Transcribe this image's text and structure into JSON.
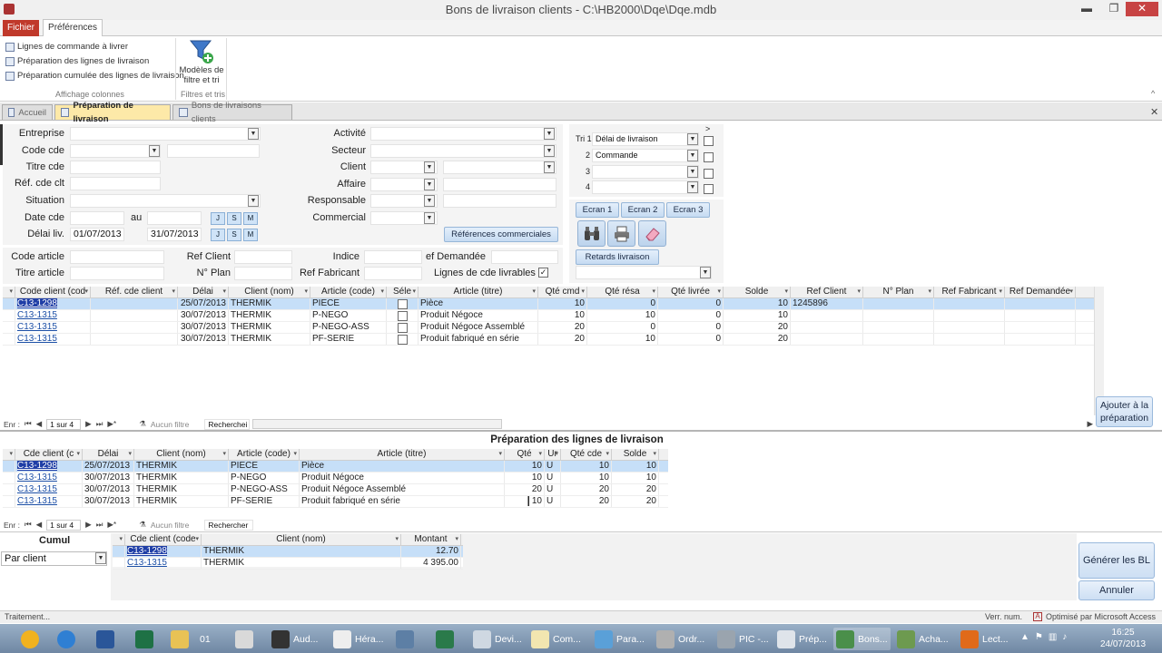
{
  "window": {
    "title": "Bons de livraison clients - C:\\HB2000\\Dqe\\Dqe.mdb",
    "minimize": "▬",
    "restore": "❐",
    "close": "✕"
  },
  "ribbon": {
    "file_tab": "Fichier",
    "prefs_tab": "Préférences",
    "items": [
      "Lignes de commande à livrer",
      "Préparation des lignes de livraison",
      "Préparation cumulée des lignes de livraison"
    ],
    "group1": "Affichage colonnes",
    "models_label": "Modèles de filtre et tri",
    "group2": "Filtres et tris"
  },
  "doc_tabs": [
    "Accueil",
    "Préparation de livraison",
    "Bons de livraisons clients"
  ],
  "filters": {
    "entreprise": "Entreprise",
    "code_cde": "Code cde",
    "titre_cde": "Titre cde",
    "ref_cde_clt": "Réf. cde clt",
    "situation": "Situation",
    "date_cde": "Date cde",
    "au": "au",
    "delai_liv": "Délai liv.",
    "delai_from": "01/07/2013",
    "delai_to": "31/07/2013",
    "activite": "Activité",
    "secteur": "Secteur",
    "client": "Client",
    "affaire": "Affaire",
    "responsable": "Responsable",
    "commercial": "Commercial",
    "ref_comm_btn": "Références commerciales",
    "jsm": [
      "J",
      "S",
      "M"
    ]
  },
  "sort": {
    "tri": "Tri 1",
    "rows": [
      {
        "n": "",
        "v": "Délai de livraison"
      },
      {
        "n": "2",
        "v": "Commande"
      },
      {
        "n": "3",
        "v": ""
      },
      {
        "n": "4",
        "v": ""
      }
    ],
    "gt": ">",
    "ecrans": [
      "Ecran 1",
      "Ecran 2",
      "Ecran 3"
    ],
    "retards": "Retards livraison"
  },
  "filters2": {
    "code_article": "Code article",
    "ref_client": "Ref Client",
    "indice": "Indice",
    "qte_demandee": "ef Demandée",
    "titre_article": "Titre article",
    "n_plan": "N° Plan",
    "ref_fabricant": "Ref Fabricant",
    "lignes_livrables": "Lignes de cde livrables",
    "checked": "✓"
  },
  "grid1": {
    "headers": [
      "Code client (cod",
      "Réf. cde client",
      "Délai",
      "Client (nom)",
      "Article (code)",
      "Séle",
      "Article (titre)",
      "Qté cmd",
      "Qté résa",
      "Qté livrée",
      "Solde",
      "Ref Client",
      "N° Plan",
      "Ref Fabricant",
      "Ref Demandée"
    ],
    "rows": [
      {
        "code": "C13-1298",
        "delai": "25/07/2013",
        "client": "THERMIK",
        "art": "PIECE",
        "titre": "Pièce",
        "cmd": "10",
        "resa": "0",
        "livree": "0",
        "solde": "10",
        "refcl": "1245896"
      },
      {
        "code": "C13-1315",
        "delai": "30/07/2013",
        "client": "THERMIK",
        "art": "P-NEGO",
        "titre": "Produit Négoce",
        "cmd": "10",
        "resa": "10",
        "livree": "0",
        "solde": "10",
        "refcl": ""
      },
      {
        "code": "C13-1315",
        "delai": "30/07/2013",
        "client": "THERMIK",
        "art": "P-NEGO-ASS",
        "titre": "Produit Négoce Assemblé",
        "cmd": "20",
        "resa": "0",
        "livree": "0",
        "solde": "20",
        "refcl": ""
      },
      {
        "code": "C13-1315",
        "delai": "30/07/2013",
        "client": "THERMIK",
        "art": "PF-SERIE",
        "titre": "Produit fabriqué en série",
        "cmd": "20",
        "resa": "10",
        "livree": "0",
        "solde": "20",
        "refcl": ""
      }
    ],
    "nav": {
      "enr": "Enr :",
      "pos": "1 sur 4",
      "nofilter": "Aucun filtre",
      "search": "Recherchei"
    }
  },
  "add_btn": "Ajouter à la préparation",
  "prep": {
    "title": "Préparation des lignes de livraison",
    "headers": [
      "Cde client (c",
      "Délai",
      "Client (nom)",
      "Article (code)",
      "Article (titre)",
      "Qté",
      "Ur",
      "Qté cde",
      "Solde"
    ],
    "rows": [
      {
        "code": "C13-1298",
        "delai": "25/07/2013",
        "client": "THERMIK",
        "art": "PIECE",
        "titre": "Pièce",
        "qte": "10",
        "u": "U",
        "cde": "10",
        "solde": "10"
      },
      {
        "code": "C13-1315",
        "delai": "30/07/2013",
        "client": "THERMIK",
        "art": "P-NEGO",
        "titre": "Produit Négoce",
        "qte": "10",
        "u": "U",
        "cde": "10",
        "solde": "10"
      },
      {
        "code": "C13-1315",
        "delai": "30/07/2013",
        "client": "THERMIK",
        "art": "P-NEGO-ASS",
        "titre": "Produit Négoce Assemblé",
        "qte": "20",
        "u": "U",
        "cde": "20",
        "solde": "20"
      },
      {
        "code": "C13-1315",
        "delai": "30/07/2013",
        "client": "THERMIK",
        "art": "PF-SERIE",
        "titre": "Produit fabriqué en série",
        "qte": "10",
        "u": "U",
        "cde": "20",
        "solde": "20"
      }
    ],
    "nav": {
      "enr": "Enr :",
      "pos": "1 sur 4",
      "nofilter": "Aucun filtre",
      "search": "Rechercher"
    }
  },
  "cumul": {
    "title": "Cumul",
    "mode": "Par client",
    "headers": [
      "Cde client (code",
      "Client (nom)",
      "Montant"
    ],
    "rows": [
      {
        "code": "C13-1298",
        "client": "THERMIK",
        "montant": "12.70"
      },
      {
        "code": "C13-1315",
        "client": "THERMIK",
        "montant": "4 395.00"
      }
    ]
  },
  "actions": {
    "generer": "Générer les BL",
    "annuler": "Annuler"
  },
  "status": {
    "left": "Traitement...",
    "verr": "Verr. num.",
    "optim": "Optimisé par Microsoft Access"
  },
  "taskbar": {
    "items": [
      "01",
      "Aud...",
      "Héra...",
      "Devi...",
      "Com...",
      "Para...",
      "Ordr...",
      "PIC -...",
      "Prép...",
      "Bons...",
      "Acha...",
      "Lect..."
    ],
    "time": "16:25",
    "date": "24/07/2013"
  },
  "colors": {
    "accent": "#1f3ea6",
    "selection": "#c6dff8",
    "tab_active": "#fde9a8",
    "file_tab": "#c0392b"
  }
}
